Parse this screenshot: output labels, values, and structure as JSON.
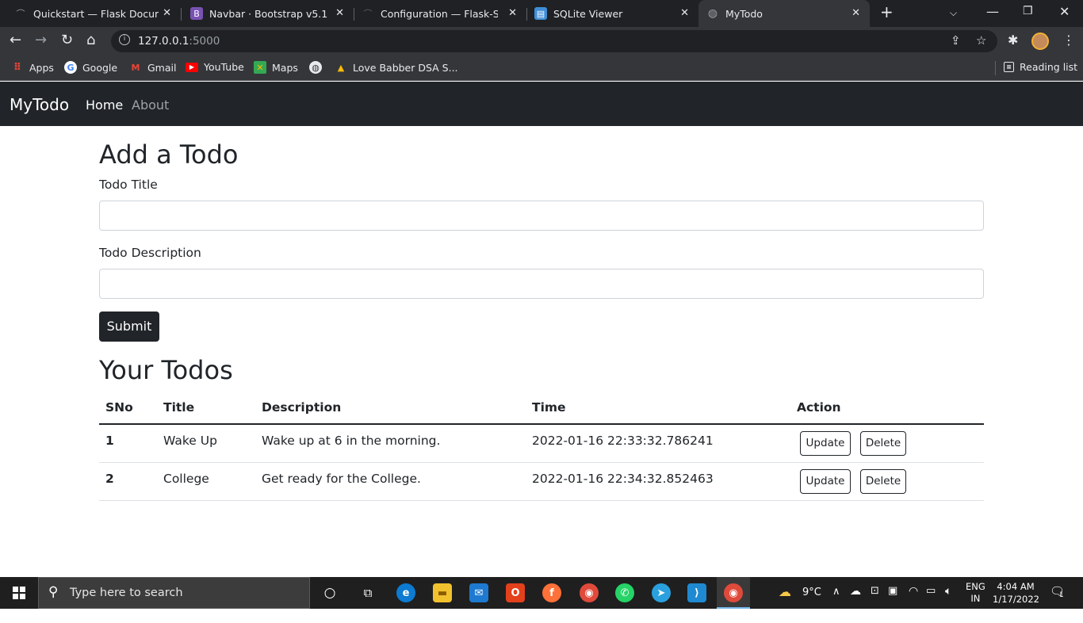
{
  "browser": {
    "tabs": [
      {
        "title": "Quickstart — Flask Documen",
        "favicon": "flask-icon"
      },
      {
        "title": "Navbar · Bootstrap v5.1",
        "favicon": "B"
      },
      {
        "title": "Configuration — Flask-SQLAl",
        "favicon": "flask-icon"
      },
      {
        "title": "SQLite Viewer",
        "favicon": "sqlite-icon"
      },
      {
        "title": "MyTodo",
        "favicon": "globe-icon"
      }
    ],
    "url_host": "127.0.0.1",
    "url_port": ":5000",
    "bookmarks": [
      {
        "label": "Apps"
      },
      {
        "label": "Google"
      },
      {
        "label": "Gmail"
      },
      {
        "label": "YouTube"
      },
      {
        "label": "Maps"
      },
      {
        "label": ""
      },
      {
        "label": "Love Babber DSA S..."
      }
    ],
    "reading_list": "Reading list",
    "colors": {
      "tab_bg": "#202124",
      "toolbar_bg": "#35363a"
    }
  },
  "navbar": {
    "brand": "MyTodo",
    "links": [
      "Home",
      "About"
    ]
  },
  "form": {
    "heading": "Add a Todo",
    "title_label": "Todo Title",
    "title_value": "",
    "desc_label": "Todo Description",
    "desc_value": "",
    "submit_label": "Submit"
  },
  "todos": {
    "heading": "Your Todos",
    "columns": [
      "SNo",
      "Title",
      "Description",
      "Time",
      "Action"
    ],
    "rows": [
      {
        "sno": "1",
        "title": "Wake Up",
        "description": "Wake up at 6 in the morning.",
        "time": "2022-01-16 22:33:32.786241",
        "update": "Update",
        "delete": "Delete"
      },
      {
        "sno": "2",
        "title": "College",
        "description": "Get ready for the College.",
        "time": "2022-01-16 22:34:32.852463",
        "update": "Update",
        "delete": "Delete"
      }
    ]
  },
  "taskbar": {
    "search_placeholder": "Type here to search",
    "temperature": "9°C",
    "lang_top": "ENG",
    "lang_bottom": "IN",
    "time": "4:04 AM",
    "date": "1/17/2022",
    "notifications": "1"
  },
  "theme": {
    "dark": "#212529",
    "muted": "#9da2a7"
  }
}
